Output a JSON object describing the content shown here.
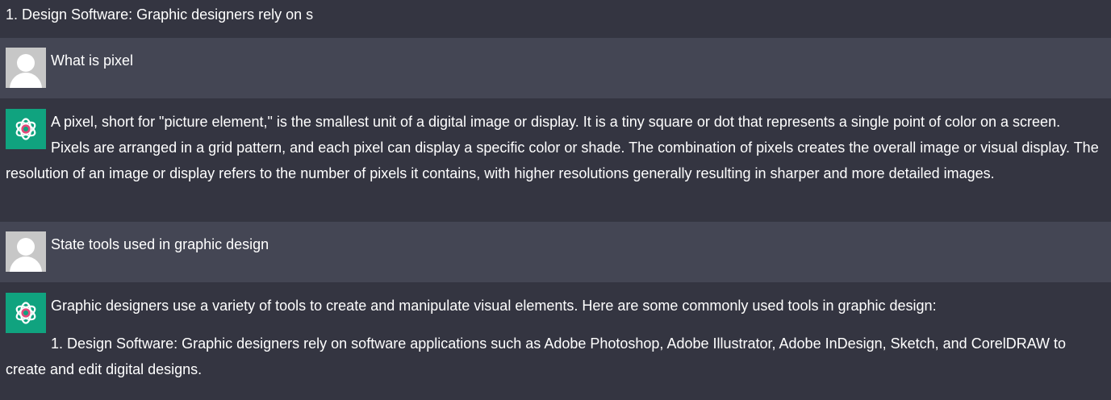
{
  "messages": [
    {
      "role": "assistant",
      "text": "1. Design Software: Graphic designers rely on s"
    },
    {
      "role": "user",
      "text": "What is pixel"
    },
    {
      "role": "assistant",
      "text": "A pixel, short for \"picture element,\" is the smallest unit of a digital image or display. It is a tiny square or dot that represents a single point of color on a screen. Pixels are arranged in a grid pattern, and each pixel can display a specific color or shade. The combination of pixels creates the overall image or visual display. The resolution of an image or display refers to the number of pixels it contains, with higher resolutions generally resulting in sharper and more detailed images."
    },
    {
      "role": "user",
      "text": "State tools used in graphic design"
    },
    {
      "role": "assistant",
      "paragraphs": [
        "Graphic designers use a variety of tools to create and manipulate visual elements. Here are some commonly used tools in graphic design:",
        "1. Design Software: Graphic designers rely on software applications such as Adobe Photoshop, Adobe Illustrator, Adobe InDesign, Sketch, and CorelDRAW to create and edit digital designs."
      ]
    }
  ],
  "icons": {
    "user_avatar": "user-avatar-icon",
    "assistant_avatar": "openai-logo-icon"
  },
  "colors": {
    "assistant_bg": "#343541",
    "user_bg": "#444654",
    "assistant_avatar_bg": "#10a37f",
    "user_avatar_bg": "#c7c7c7",
    "text": "#ffffff"
  }
}
